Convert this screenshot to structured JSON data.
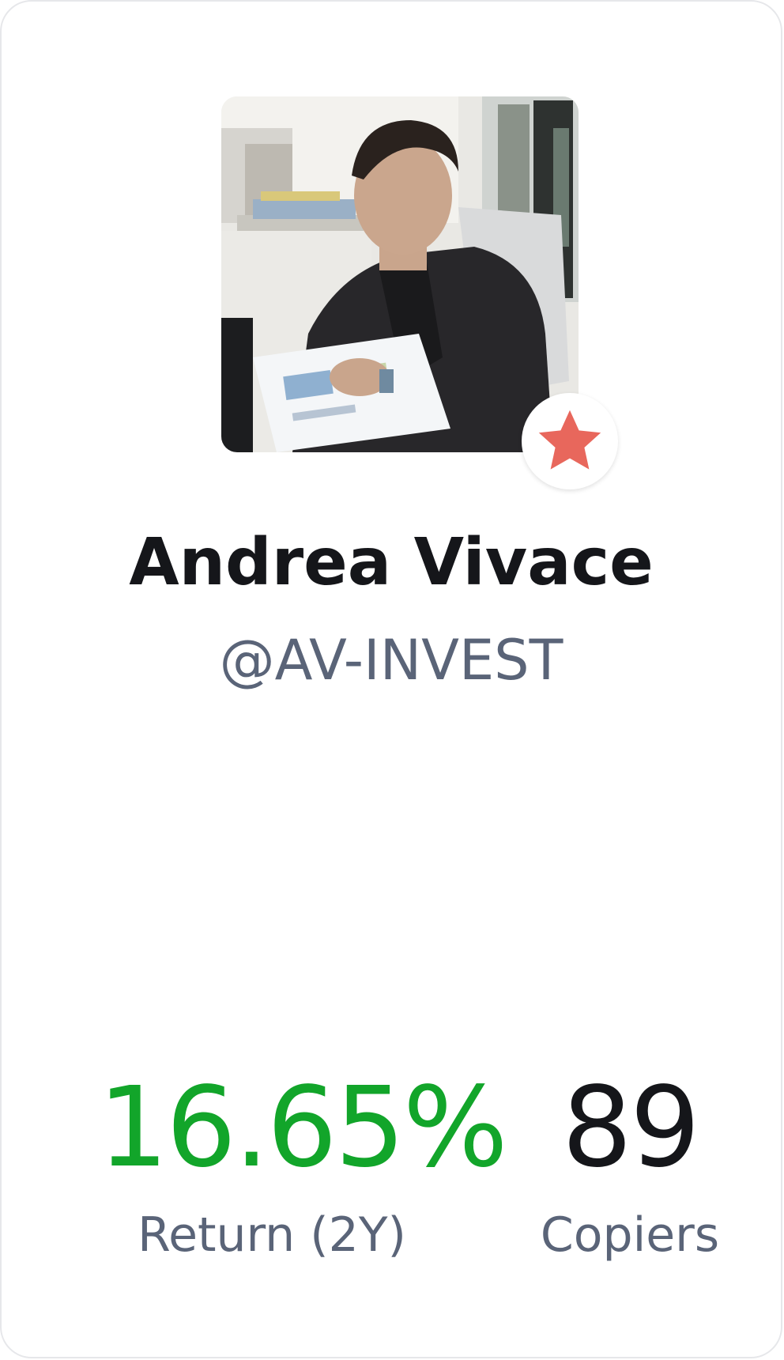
{
  "profile": {
    "name": "Andrea Vivace",
    "handle": "@AV-INVEST",
    "avatar_icon": "trader-photo",
    "badge_icon": "star-icon",
    "badge_color": "#e8675c"
  },
  "stats": {
    "return_value": "16.65%",
    "return_label": "Return (2Y)",
    "return_color": "#12a52a",
    "copiers_value": "89",
    "copiers_label": "Copiers",
    "copiers_color": "#15161a"
  }
}
